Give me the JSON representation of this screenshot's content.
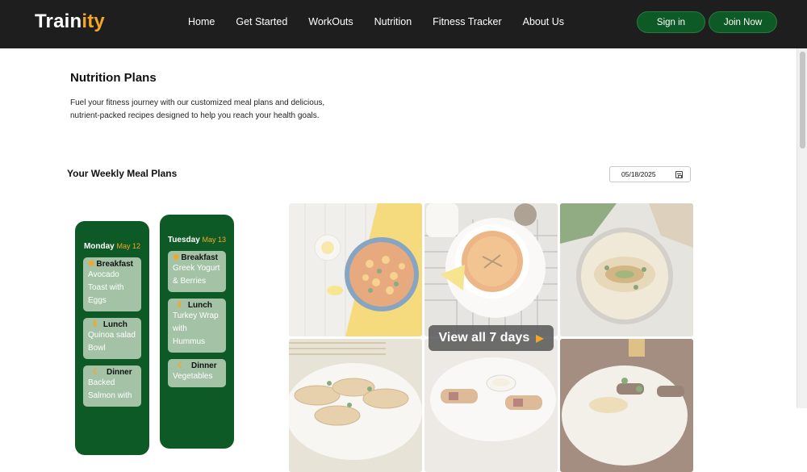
{
  "brand": {
    "name_main": "Train",
    "name_accent": "ity",
    "accent_color": "#f5a623",
    "green": "#0e5a26"
  },
  "nav": {
    "items": [
      "Home",
      "Get Started",
      "WorkOuts",
      "Nutrition",
      "Fitness Tracker",
      "About Us"
    ]
  },
  "auth": {
    "signin": "Sign in",
    "join": "Join Now"
  },
  "page": {
    "title": "Nutrition Plans",
    "intro": "Fuel your fitness journey with our customized meal plans and delicious, nutrient-packed recipes designed to help you reach your health goals."
  },
  "weekly": {
    "title": "Your Weekly Meal Plans",
    "date_value": "05/18/2025",
    "calendar_icon": "calendar-icon"
  },
  "days": [
    {
      "day": "Monday",
      "date": "May 12",
      "meals": [
        {
          "type": "Breakfast",
          "icon": "sun-icon",
          "food": "Avocado Toast with Eggs"
        },
        {
          "type": "Lunch",
          "icon": "fork-knife-icon",
          "food": "Quinoa salad Bowl"
        },
        {
          "type": "Dinner",
          "icon": "moon-icon",
          "food": "Backed Salmon with"
        }
      ]
    },
    {
      "day": "Tuesday",
      "date": "May 13",
      "meals": [
        {
          "type": "Breakfast",
          "icon": "sun-icon",
          "food": "Greek Yogurt & Berries"
        },
        {
          "type": "Lunch",
          "icon": "fork-knife-icon",
          "food": "Turkey Wrap with Hummus"
        },
        {
          "type": "Dinner",
          "icon": "moon-icon",
          "food": "Vegetables"
        }
      ]
    }
  ],
  "gallery": {
    "button": "View all 7 days",
    "arrow_icon": "caret-right-icon"
  }
}
